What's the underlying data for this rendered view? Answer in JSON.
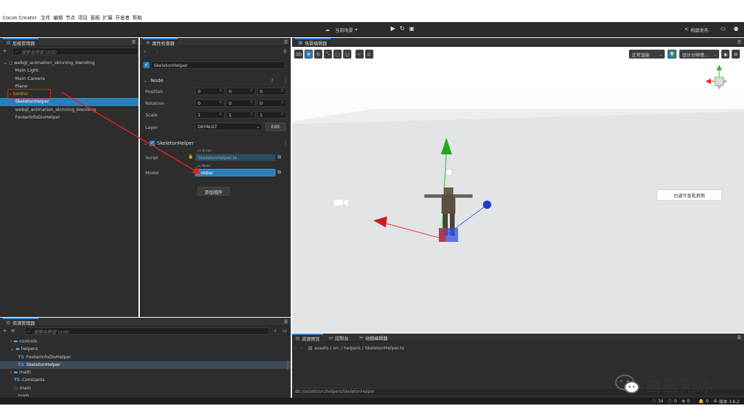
{
  "menubar": {
    "app": "Cocos Creator",
    "items": [
      "文件",
      "编辑",
      "节点",
      "项目",
      "面板",
      "扩展",
      "开发者",
      "帮助"
    ]
  },
  "toolbar": {
    "scene_label": "当前场景",
    "build_label": "构建发布"
  },
  "hierarchy": {
    "title": "层级管理器",
    "search_placeholder": "搜索名称或 UUID",
    "root": "webgl_animation_skinning_blending",
    "items": [
      "Main Light",
      "Main Camera",
      "Plane",
      "Soldier",
      "SkeletonHelper",
      "webgl_animation_skinning_blending",
      "FooterInfoDivHelper"
    ]
  },
  "inspector": {
    "title": "属性检查器",
    "node_name": "SkeletonHelper",
    "section": "Node",
    "position": {
      "label": "Position",
      "x": "0",
      "y": "0",
      "z": "0"
    },
    "rotation": {
      "label": "Rotation",
      "x": "0",
      "y": "0",
      "z": "0"
    },
    "scale": {
      "label": "Scale",
      "x": "1",
      "y": "1",
      "z": "1"
    },
    "layer": {
      "label": "Layer",
      "value": "DEFAULT",
      "edit": "Edit"
    },
    "component": "SkeletonHelper",
    "script": {
      "label": "Script",
      "tag": "cc.Script",
      "value": "SkeletonHelper.ts"
    },
    "model": {
      "label": "Model",
      "tag": "cc.Node",
      "value": "Soldier"
    },
    "add_component": "添加组件",
    "axis": {
      "x": "X",
      "y": "Y",
      "z": "Z"
    }
  },
  "scene": {
    "title": "场景编辑器",
    "mode_3d": "3D",
    "shading": "正常渲染",
    "resolution": "设计分辨率...",
    "tooltip": "右键可查看原图"
  },
  "assets": {
    "title": "资源管理器",
    "search_placeholder": "搜索名称或 UUID",
    "items": [
      "controls",
      "helpers",
      "FooterInfoDivHelper",
      "SkeletonHelper",
      "math",
      "Constants",
      "main",
      "main"
    ],
    "ts_badge": "TS"
  },
  "bottom": {
    "tabs": [
      "资源预览",
      "控制台",
      "动画编辑器"
    ],
    "path": "assets / src / helpers / SkeletonHelper.ts",
    "db_path": "db://assets/src/helpers/SkeletonHelper"
  },
  "status": {
    "info": "34",
    "warn": "0",
    "error": "0",
    "notify": "0",
    "version": "版本 3.6.2"
  },
  "watermark": "白玉无冰"
}
